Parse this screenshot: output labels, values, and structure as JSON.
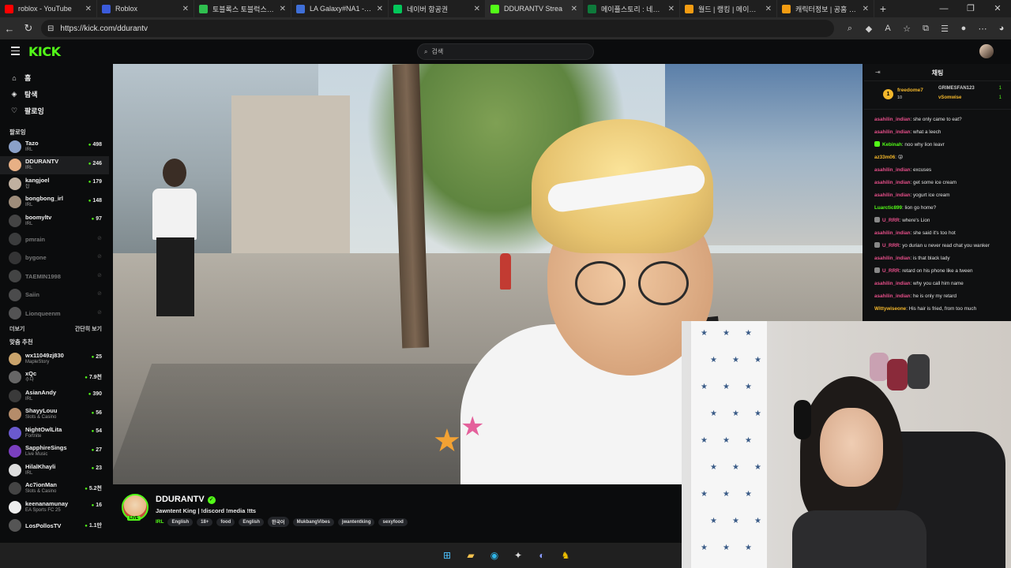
{
  "browser": {
    "tabs": [
      {
        "title": "roblox - YouTube",
        "color": "#ff0000"
      },
      {
        "title": "Roblox",
        "color": "#3b5bdb"
      },
      {
        "title": "토블록스 토블럭스 추석",
        "color": "#2fbf4f"
      },
      {
        "title": "LA Galaxy#NA1 - Summ",
        "color": "#3f6fd8"
      },
      {
        "title": "네이버 항공권",
        "color": "#03c75a"
      },
      {
        "title": "DDURANTV Strea",
        "color": "#53fc18",
        "active": true
      },
      {
        "title": "메이플스토리 : 네이버",
        "color": "#0e7a3b"
      },
      {
        "title": "월드 | 랭킹 | 메이플스",
        "color": "#f39c12"
      },
      {
        "title": "캐릭터정보 | 공홈 | 메",
        "color": "#f39c12"
      }
    ],
    "url": "https://kick.com/ddurantv"
  },
  "kick": {
    "logo": "KICK",
    "search_placeholder": "검색"
  },
  "sidebar": {
    "nav": [
      {
        "label": "홈",
        "icon": "home-icon"
      },
      {
        "label": "탐색",
        "icon": "browse-icon"
      },
      {
        "label": "팔로잉",
        "icon": "heart-icon"
      }
    ],
    "following_label": "팔로잉",
    "following": [
      {
        "name": "Tazo",
        "cat": "IRL",
        "viewers": "498",
        "color": "#8aa0c8"
      },
      {
        "name": "DDURANTV",
        "cat": "IRL",
        "viewers": "246",
        "color": "#e8b085",
        "active": true
      },
      {
        "name": "kangjoel",
        "cat": "잡",
        "viewers": "179",
        "color": "#c0b0a0"
      },
      {
        "name": "bongbong_irl",
        "cat": "IRL",
        "viewers": "148",
        "color": "#9e8c7a"
      },
      {
        "name": "boomyltv",
        "cat": "IRL",
        "viewers": "97",
        "color": "#444"
      },
      {
        "name": "pmrain",
        "cat": "",
        "viewers": "",
        "color": "#777",
        "offline": true
      },
      {
        "name": "bygone",
        "cat": "",
        "viewers": "",
        "color": "#666",
        "offline": true
      },
      {
        "name": "TAEMIN1998",
        "cat": "",
        "viewers": "",
        "color": "#888",
        "offline": true
      },
      {
        "name": "Saiin",
        "cat": "",
        "viewers": "",
        "color": "#999",
        "offline": true
      },
      {
        "name": "Lionqueenm",
        "cat": "",
        "viewers": "",
        "color": "#aaa",
        "offline": true
      }
    ],
    "more_label": "더보기",
    "collapse_label": "간단히 보기",
    "recommended_label": "맞춤 추천",
    "recommended": [
      {
        "name": "wx11049zj830",
        "cat": "MapleStory",
        "viewers": "25",
        "color": "#c9a36b"
      },
      {
        "name": "xQc",
        "cat": "수다",
        "viewers": "7.9천",
        "color": "#666"
      },
      {
        "name": "AsianAndy",
        "cat": "IRL",
        "viewers": "390",
        "color": "#3a3a3a"
      },
      {
        "name": "ShayyLouu",
        "cat": "Slots & Casino",
        "viewers": "56",
        "color": "#b58c6a"
      },
      {
        "name": "NightOwlLita",
        "cat": "Fortnite",
        "viewers": "54",
        "color": "#6a5acd"
      },
      {
        "name": "SapphireSings",
        "cat": "Live Music",
        "viewers": "27",
        "color": "#7a3fbf"
      },
      {
        "name": "HilalKhayli",
        "cat": "IRL",
        "viewers": "23",
        "color": "#ddd"
      },
      {
        "name": "Ac7ionMan",
        "cat": "Slots & Casino",
        "viewers": "5.2천",
        "color": "#444"
      },
      {
        "name": "keenanamunay",
        "cat": "EA Sports FC 25",
        "viewers": "16",
        "color": "#eee"
      },
      {
        "name": "LosPollosTV",
        "cat": "",
        "viewers": "1.1만",
        "color": "#555"
      }
    ]
  },
  "stream": {
    "channel": "DDURANTV",
    "live_badge": "LIVE",
    "title": "Jawntent King | !discord !media !tts",
    "category": "IRL",
    "tags": [
      "English",
      "18+",
      "food",
      "English",
      "한국어",
      "MukbangVibes",
      "jwantentking",
      "sexyfood"
    ]
  },
  "chat": {
    "title": "채팅",
    "pinned": {
      "top_gifter": "freedome7",
      "top_gifter_count": "10",
      "second": "GRIMESFAN123",
      "second_count": "1",
      "third": "vSomwise",
      "third_count": "1"
    },
    "messages": [
      {
        "user": "asahilin_indian",
        "color": "#e64f8a",
        "text": "she only came to eat?"
      },
      {
        "user": "asahilin_indian",
        "color": "#e64f8a",
        "text": "what a leech"
      },
      {
        "user": "Kebinah",
        "color": "#53fc18",
        "text": "noo why lion leavr",
        "badge": "#53fc18"
      },
      {
        "user": "az33m06",
        "color": "#f3b72b",
        "text": "😜"
      },
      {
        "user": "asahilin_indian",
        "color": "#e64f8a",
        "text": "excuses"
      },
      {
        "user": "asahilin_indian",
        "color": "#e64f8a",
        "text": "get some ice cream"
      },
      {
        "user": "asahilin_indian",
        "color": "#e64f8a",
        "text": "yogurt ice cream"
      },
      {
        "user": "Luarctic899",
        "color": "#53fc18",
        "text": "lion go home?"
      },
      {
        "user": "U_RRR",
        "color": "#e64f8a",
        "text": "where's Lion",
        "badge": "#888"
      },
      {
        "user": "asahilin_indian",
        "color": "#e64f8a",
        "text": "she said it's too hot"
      },
      {
        "user": "U_RRR",
        "color": "#e64f8a",
        "text": "yo durian u never read chat you wanker",
        "badge": "#888",
        "wrap": true
      },
      {
        "user": "asahilin_indian",
        "color": "#e64f8a",
        "text": "is that black lady"
      },
      {
        "user": "U_RRR",
        "color": "#e64f8a",
        "text": "retard on his phone like a tween",
        "badge": "#888"
      },
      {
        "user": "asahilin_indian",
        "color": "#e64f8a",
        "text": "why you call him name"
      },
      {
        "user": "asahilin_indian",
        "color": "#e64f8a",
        "text": "he is only my retard"
      },
      {
        "user": "Wittywiseone",
        "color": "#f3b72b",
        "text": "His hair is fried, from too much"
      }
    ]
  }
}
